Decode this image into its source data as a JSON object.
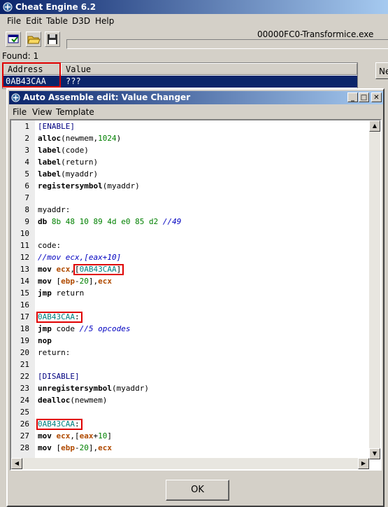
{
  "main_window": {
    "title": "Cheat Engine 6.2",
    "menu": [
      "File",
      "Edit",
      "Table",
      "D3D",
      "Help"
    ],
    "process": "00000FC0-Transformice.exe",
    "found_label": "Found: 1",
    "columns": [
      "Address",
      "Value"
    ],
    "result_row": {
      "address": "0AB43CAA",
      "value": "???"
    },
    "right_button_label": "Ne"
  },
  "dialog": {
    "title": "Auto Assemble edit: Value Changer",
    "menu": [
      "File",
      "View",
      "Template"
    ],
    "ok_label": "OK"
  },
  "code_lines": [
    {
      "n": "1",
      "text": "[ENABLE]"
    },
    {
      "n": "2",
      "text": "alloc(newmem,1024)"
    },
    {
      "n": "3",
      "text": "label(code)"
    },
    {
      "n": "4",
      "text": "label(return)"
    },
    {
      "n": "5",
      "text": "label(myaddr)"
    },
    {
      "n": "6",
      "text": "registersymbol(myaddr)"
    },
    {
      "n": "7",
      "text": ""
    },
    {
      "n": "8",
      "text": "myaddr:"
    },
    {
      "n": "9",
      "text": "db 8b 48 10 89 4d e0 85 d2 //49"
    },
    {
      "n": "10",
      "text": ""
    },
    {
      "n": "11",
      "text": "code:"
    },
    {
      "n": "12",
      "text": "//mov ecx,[eax+10]"
    },
    {
      "n": "13",
      "text": "mov ecx,[0AB43CAA]"
    },
    {
      "n": "14",
      "text": "mov [ebp-20],ecx"
    },
    {
      "n": "15",
      "text": "jmp return"
    },
    {
      "n": "16",
      "text": ""
    },
    {
      "n": "17",
      "text": "0AB43CAA:"
    },
    {
      "n": "18",
      "text": "jmp code //5 opcodes"
    },
    {
      "n": "19",
      "text": "nop"
    },
    {
      "n": "20",
      "text": "return:"
    },
    {
      "n": "21",
      "text": ""
    },
    {
      "n": "22",
      "text": "[DISABLE]"
    },
    {
      "n": "23",
      "text": "unregistersymbol(myaddr)"
    },
    {
      "n": "24",
      "text": "dealloc(newmem)"
    },
    {
      "n": "25",
      "text": ""
    },
    {
      "n": "26",
      "text": "0AB43CAA:"
    },
    {
      "n": "27",
      "text": "mov ecx,[eax+10]"
    },
    {
      "n": "28",
      "text": "mov [ebp-20],ecx"
    }
  ],
  "icons": [
    "cheat-engine-icon",
    "select-process-icon",
    "open-folder-icon",
    "save-disk-icon",
    "minimize-icon",
    "maximize-icon",
    "close-icon"
  ]
}
